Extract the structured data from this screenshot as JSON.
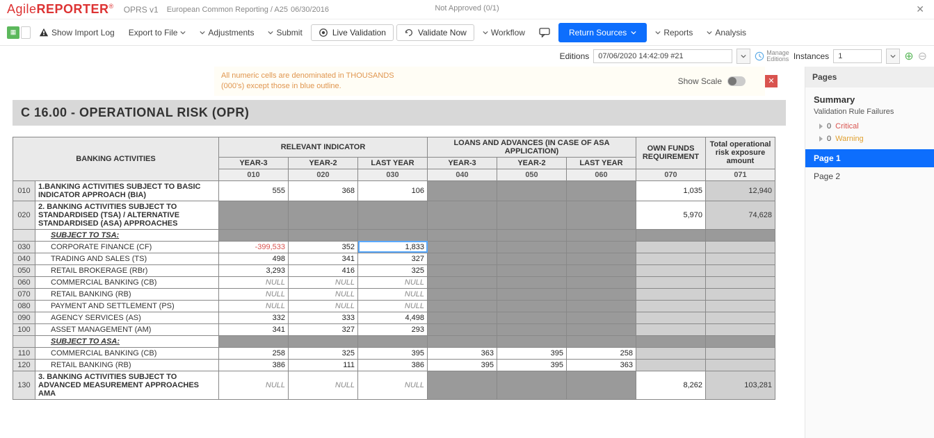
{
  "app": {
    "logo1": "Agile",
    "logo2": "REPORTER",
    "reg": "®"
  },
  "header": {
    "product": "OPRS v1",
    "breadcrumb": "European Common Reporting / A25",
    "date": "06/30/2016",
    "status": "Not Approved (0/1)"
  },
  "toolbar": {
    "show_import": "Show Import Log",
    "export": "Export to File",
    "adjustments": "Adjustments",
    "submit": "Submit",
    "live_validation": "Live Validation",
    "validate_now": "Validate Now",
    "workflow": "Workflow",
    "return_sources": "Return Sources",
    "reports": "Reports",
    "analysis": "Analysis"
  },
  "editions": {
    "label": "Editions",
    "value": "07/06/2020 14:42:09 #21",
    "manage": "Manage",
    "editions_word": "Editions",
    "instances_label": "Instances",
    "instances_value": "1"
  },
  "notice": {
    "text": "All numeric cells are denominated in THOUSANDS (000's) except those in blue outline.",
    "show_scale": "Show Scale"
  },
  "report": {
    "title": "C 16.00 - OPERATIONAL RISK (OPR)",
    "head_banking": "BANKING ACTIVITIES",
    "head_relevant": "RELEVANT INDICATOR",
    "head_loans": "LOANS AND ADVANCES (IN CASE OF ASA APPLICATION)",
    "head_own": "OWN FUNDS REQUIREMENT",
    "head_total": "Total operational risk exposure amount",
    "year3": "YEAR-3",
    "year2": "YEAR-2",
    "lastyear": "LAST YEAR",
    "codes": [
      "010",
      "020",
      "030",
      "040",
      "050",
      "060",
      "070",
      "071"
    ]
  },
  "rows": [
    {
      "code": "010",
      "label": "1.BANKING ACTIVITIES SUBJECT TO BASIC INDICATOR APPROACH (BIA)",
      "type": "main",
      "v": [
        "555",
        "368",
        "106",
        "",
        "",
        "",
        "1,035",
        "12,940"
      ]
    },
    {
      "code": "020",
      "label": "2. BANKING ACTIVITIES SUBJECT TO STANDARDISED (TSA) / ALTERNATIVE STANDARDISED (ASA) APPROACHES",
      "type": "main",
      "v": [
        "",
        "",
        "",
        "",
        "",
        "",
        "5,970",
        "74,628"
      ]
    },
    {
      "code": "",
      "label": "SUBJECT TO TSA:",
      "type": "section",
      "v": [
        "",
        "",
        "",
        "",
        "",
        "",
        "",
        ""
      ]
    },
    {
      "code": "030",
      "label": "CORPORATE FINANCE (CF)",
      "type": "sub",
      "v": [
        "-399,533",
        "352",
        "1,833",
        "",
        "",
        "",
        "",
        ""
      ],
      "neg": 0,
      "sel": 2
    },
    {
      "code": "040",
      "label": "TRADING AND SALES (TS)",
      "type": "sub",
      "v": [
        "498",
        "341",
        "327",
        "",
        "",
        "",
        "",
        ""
      ]
    },
    {
      "code": "050",
      "label": "RETAIL BROKERAGE (RBr)",
      "type": "sub",
      "v": [
        "3,293",
        "416",
        "325",
        "",
        "",
        "",
        "",
        ""
      ]
    },
    {
      "code": "060",
      "label": "COMMERCIAL BANKING (CB)",
      "type": "sub",
      "v": [
        "NULL",
        "NULL",
        "NULL",
        "",
        "",
        "",
        "",
        ""
      ],
      "null": true
    },
    {
      "code": "070",
      "label": "RETAIL BANKING (RB)",
      "type": "sub",
      "v": [
        "NULL",
        "NULL",
        "NULL",
        "",
        "",
        "",
        "",
        ""
      ],
      "null": true
    },
    {
      "code": "080",
      "label": "PAYMENT AND SETTLEMENT (PS)",
      "type": "sub",
      "v": [
        "NULL",
        "NULL",
        "NULL",
        "",
        "",
        "",
        "",
        ""
      ],
      "null": true
    },
    {
      "code": "090",
      "label": "AGENCY SERVICES (AS)",
      "type": "sub",
      "v": [
        "332",
        "333",
        "4,498",
        "",
        "",
        "",
        "",
        ""
      ]
    },
    {
      "code": "100",
      "label": "ASSET MANAGEMENT (AM)",
      "type": "sub",
      "v": [
        "341",
        "327",
        "293",
        "",
        "",
        "",
        "",
        ""
      ]
    },
    {
      "code": "",
      "label": "SUBJECT TO ASA:",
      "type": "section",
      "v": [
        "",
        "",
        "",
        "",
        "",
        "",
        "",
        ""
      ]
    },
    {
      "code": "110",
      "label": "COMMERCIAL BANKING (CB)",
      "type": "sub",
      "v": [
        "258",
        "325",
        "395",
        "363",
        "395",
        "258",
        "",
        ""
      ]
    },
    {
      "code": "120",
      "label": "RETAIL BANKING (RB)",
      "type": "sub",
      "v": [
        "386",
        "111",
        "386",
        "395",
        "395",
        "363",
        "",
        ""
      ]
    },
    {
      "code": "130",
      "label": "3. BANKING ACTIVITIES SUBJECT TO ADVANCED MEASUREMENT APPROACHES AMA",
      "type": "main",
      "v": [
        "NULL",
        "NULL",
        "NULL",
        "",
        "",
        "",
        "8,262",
        "103,281"
      ],
      "null3": true
    }
  ],
  "right": {
    "pages": "Pages",
    "summary": "Summary",
    "vrf": "Validation Rule Failures",
    "crit_n": "0",
    "crit": "Critical",
    "warn_n": "0",
    "warn": "Warning",
    "page1": "Page 1",
    "page2": "Page 2"
  }
}
